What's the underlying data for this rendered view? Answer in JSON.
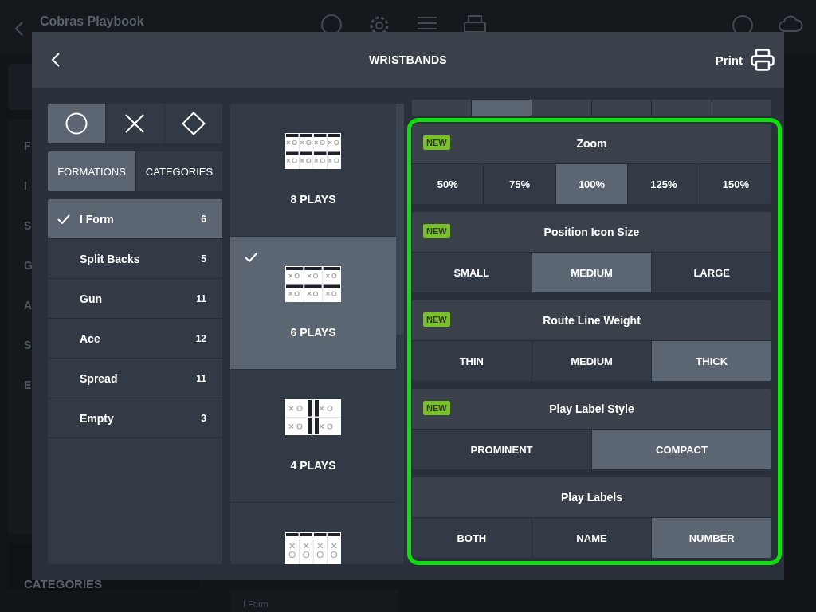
{
  "app_bar": {
    "title": "Cobras Playbook"
  },
  "background_sidebar": {
    "items": [
      "F",
      "I",
      "S",
      "G",
      "A",
      "S",
      "E"
    ],
    "footer": "CATEGORIES"
  },
  "background_card": {
    "subtitle": "I Form"
  },
  "dialog": {
    "title": "WRISTBANDS",
    "print_label": "Print"
  },
  "shape_tabs": [
    {
      "kind": "circle",
      "selected": true
    },
    {
      "kind": "cross",
      "selected": false
    },
    {
      "kind": "diamond",
      "selected": false
    }
  ],
  "list_tabs": [
    {
      "label": "FORMATIONS",
      "selected": true
    },
    {
      "label": "CATEGORIES",
      "selected": false
    }
  ],
  "formations": [
    {
      "name": "I Form",
      "count": "6",
      "selected": true
    },
    {
      "name": "Split Backs",
      "count": "5",
      "selected": false
    },
    {
      "name": "Gun",
      "count": "11",
      "selected": false
    },
    {
      "name": "Ace",
      "count": "12",
      "selected": false
    },
    {
      "name": "Spread",
      "count": "11",
      "selected": false
    },
    {
      "name": "Empty",
      "count": "3",
      "selected": false
    }
  ],
  "layouts": [
    {
      "kind": "grid8",
      "label": "8 PLAYS",
      "selected": false
    },
    {
      "kind": "grid6",
      "label": "6 PLAYS",
      "selected": true
    },
    {
      "kind": "grid4",
      "label": "4 PLAYS",
      "selected": false
    },
    {
      "kind": "vertical4",
      "selected": false
    }
  ],
  "scrolled_option_row": [
    {
      "selected": false
    },
    {
      "selected": true
    },
    {
      "selected": false
    },
    {
      "selected": false
    },
    {
      "selected": false
    },
    {
      "selected": false
    }
  ],
  "settings": [
    {
      "title": "Zoom",
      "badge": "NEW",
      "options": [
        {
          "label": "50%",
          "selected": false
        },
        {
          "label": "75%",
          "selected": false
        },
        {
          "label": "100%",
          "selected": true
        },
        {
          "label": "125%",
          "selected": false
        },
        {
          "label": "150%",
          "selected": false
        }
      ]
    },
    {
      "title": "Position Icon Size",
      "badge": "NEW",
      "options": [
        {
          "label": "SMALL",
          "selected": false
        },
        {
          "label": "MEDIUM",
          "selected": true
        },
        {
          "label": "LARGE",
          "selected": false
        }
      ]
    },
    {
      "title": "Route Line Weight",
      "badge": "NEW",
      "options": [
        {
          "label": "THIN",
          "selected": false
        },
        {
          "label": "MEDIUM",
          "selected": false
        },
        {
          "label": "THICK",
          "selected": true
        }
      ]
    },
    {
      "title": "Play Label Style",
      "badge": "NEW",
      "options": [
        {
          "label": "PROMINENT",
          "selected": false
        },
        {
          "label": "COMPACT",
          "selected": true
        }
      ]
    },
    {
      "title": "Play Labels",
      "options": [
        {
          "label": "BOTH",
          "selected": false
        },
        {
          "label": "NAME",
          "selected": false
        },
        {
          "label": "NUMBER",
          "selected": true
        }
      ]
    }
  ]
}
